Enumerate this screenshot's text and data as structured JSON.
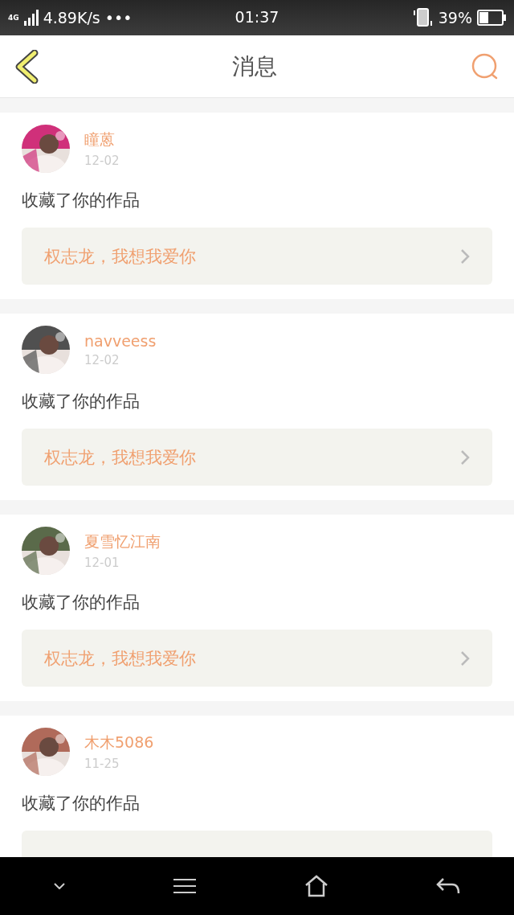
{
  "status_bar": {
    "network": "4G",
    "speed": "4.89K/s",
    "more": "•••",
    "time": "01:37",
    "battery": "39%"
  },
  "header": {
    "title": "消息"
  },
  "messages": [
    {
      "name": "瞳蒽",
      "date": "12-02",
      "action": "收藏了你的作品",
      "link": "权志龙，我想我爱你"
    },
    {
      "name": "navveess",
      "date": "12-02",
      "action": "收藏了你的作品",
      "link": "权志龙，我想我爱你"
    },
    {
      "name": "夏雪忆江南",
      "date": "12-01",
      "action": "收藏了你的作品",
      "link": "权志龙，我想我爱你"
    },
    {
      "name": "木木5086",
      "date": "11-25",
      "action": "收藏了你的作品"
    }
  ]
}
